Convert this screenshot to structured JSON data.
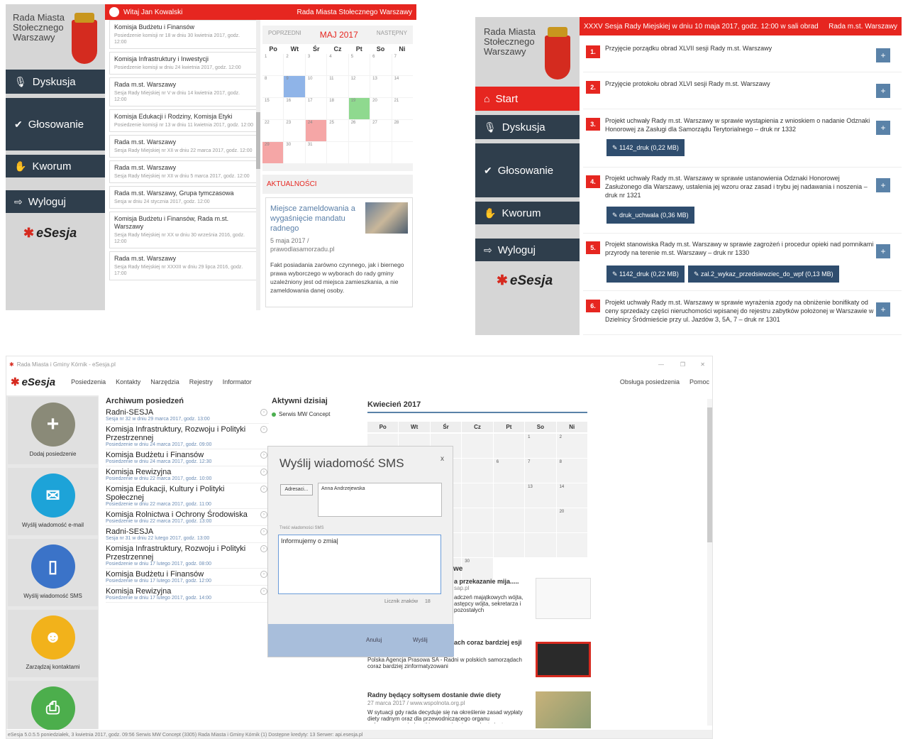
{
  "panelA": {
    "city": "Rada Miasta Stołecznego Warszawy",
    "header_user": "Witaj Jan Kowalski",
    "header_org": "Rada Miasta Stołecznego Warszawy",
    "nav": {
      "dyskusja": "Dyskusja",
      "glosowanie": "Głosowanie",
      "kworum": "Kworum",
      "wyloguj": "Wyloguj"
    },
    "logo": "eSesja",
    "items": [
      {
        "title": "Komisja Budżetu i Finansów",
        "sub": "Posiedzenie komisji nr 18 w dniu 30 kwietnia 2017, godz. 12:00"
      },
      {
        "title": "Komisja Infrastruktury i Inwestycji",
        "sub": "Posiedzenie komisji w dniu 24 kwietnia 2017, godz. 12:00"
      },
      {
        "title": "Rada m.st. Warszawy",
        "sub": "Sesja Rady Miejskiej nr V w dniu 14 kwietnia 2017, godz. 12:00"
      },
      {
        "title": "Komisja Edukacji i Rodziny, Komisja Etyki",
        "sub": "Posiedzenie komisji nr 13 w dniu 11 kwietnia 2017, godz. 12:00"
      },
      {
        "title": "Rada m.st. Warszawy",
        "sub": "Sesja Rady Miejskiej nr XII w dniu 22 marca 2017, godz. 12:00"
      },
      {
        "title": "Rada m.st. Warszawy",
        "sub": "Sesja Rady Miejskiej nr XII w dniu 5 marca 2017, godz. 12:00"
      },
      {
        "title": "Rada m.st. Warszawy, Grupa tymczasowa",
        "sub": "Sesja w dniu 24 stycznia 2017, godz. 12:00"
      },
      {
        "title": "Komisja Budżetu i Finansów, Rada m.st. Warszawy",
        "sub": "Sesja Rady Miejskiej nr XX w dniu 30 września 2016, godz. 12:00"
      },
      {
        "title": "Rada m.st. Warszawy",
        "sub": "Sesja Rady Miejskiej nr XXXIII w dniu 29 lipca 2016, godz. 17:00"
      }
    ],
    "cal": {
      "prev": "POPRZEDNI",
      "month": "MAJ 2017",
      "next": "NASTĘPNY",
      "days": [
        "Po",
        "Wt",
        "Śr",
        "Cz",
        "Pt",
        "So",
        "Ni"
      ],
      "cells": [
        "1",
        "2",
        "3",
        "4",
        "5",
        "6",
        "7",
        "8",
        "9",
        "10",
        "11",
        "12",
        "13",
        "14",
        "15",
        "16",
        "17",
        "18",
        "19",
        "20",
        "21",
        "22",
        "23",
        "24",
        "25",
        "26",
        "27",
        "28",
        "29",
        "30",
        "31",
        "",
        "",
        "",
        ""
      ],
      "colors": {
        "9": "#8fb4e8",
        "19": "#8fd98f",
        "24": "#f5a6a6",
        "29": "#f5a6a6"
      }
    },
    "news_label": "AKTUALNOŚCI",
    "news": {
      "title": "Miejsce zameldowania a wygaśnięcie mandatu radnego",
      "date": "5 maja 2017 / prawodlasamorzadu.pl",
      "body": "Fakt posiadania zarówno czynnego, jak i biernego prawa wyborczego w wyborach do rady gminy uzależniony jest od miejsca zamieszkania, a nie zameldowania danej osoby."
    }
  },
  "panelB": {
    "city": "Rada Miasta Stołecznego Warszawy",
    "header_title": "XXXV Sesja Rady Miejskiej w dniu 10 maja 2017, godz. 12:00 w sali obrad",
    "header_org": "Rada m.st. Warszawy",
    "nav": {
      "start": "Start",
      "dyskusja": "Dyskusja",
      "glosowanie": "Głosowanie",
      "kworum": "Kworum",
      "wyloguj": "Wyloguj"
    },
    "logo": "eSesja",
    "items": [
      {
        "num": "1.",
        "text": "Przyjęcie porządku obrad XLVII sesji Rady m.st. Warszawy",
        "plus": "+"
      },
      {
        "num": "2.",
        "text": "Przyjęcie protokołu obrad XLVI sesji Rady m.st. Warszawy",
        "plus": "+"
      },
      {
        "num": "3.",
        "text": "Projekt uchwały Rady m.st. Warszawy w sprawie wystąpienia z wnioskiem o nadanie Odznaki Honorowej za Zasługi dla Samorządu Terytorialnego – druk nr 1332",
        "plus": "+"
      },
      {
        "num": "4.",
        "text": "Projekt uchwały Rady m.st. Warszawy w sprawie ustanowienia Odznaki Honorowej Zasłużonego dla Warszawy, ustalenia jej wzoru oraz zasad i trybu jej nadawania i noszenia – druk nr 1321",
        "plus": "+"
      },
      {
        "num": "5.",
        "text": "Projekt stanowiska Rady m.st. Warszawy w sprawie zagrożeń i procedur opieki nad pomnikami przyrody na terenie m.st. Warszawy – druk nr 1330",
        "plus": "+"
      },
      {
        "num": "6.",
        "text": "Projekt uchwały Rady m.st. Warszawy w sprawie wyrażenia zgody na obniżenie bonifikaty od ceny sprzedaży części nieruchomości wpisanej do rejestru zabytków położonej w Warszawie w Dzielnicy Śródmieście przy ul. Jazdów 3, 5A, 7 – druk nr 1301",
        "plus": "+"
      }
    ],
    "attachments": {
      "a3": "✎ 1142_druk (0,22 MB)",
      "a4": "✎ druk_uchwala (0,36 MB)",
      "a5a": "✎ 1142_druk (0,22 MB)",
      "a5b": "✎ zal.2_wykaz_przedsiewziec_do_wpf (0,13 MB)"
    }
  },
  "panelC": {
    "window_title": "Rada Miasta i Gminy Kórnik - eSesja.pl",
    "menu": [
      "Posiedzenia",
      "Kontakty",
      "Narzędzia",
      "Rejestry",
      "Informator"
    ],
    "menu_right": [
      "Obsługa posiedzenia",
      "Pomoc"
    ],
    "logo": "eSesja",
    "tiles": [
      "Dodaj posiedzenie",
      "Wyślij wiadomość e-mail",
      "Wyślij wiadomość SMS",
      "Zarządzaj kontaktami"
    ],
    "archive_title": "Archiwum posiedzeń",
    "archive": [
      {
        "t": "Radni-SESJA",
        "s": "Sesja nr 32 w dniu 29 marca 2017, godz. 13:00"
      },
      {
        "t": "Komisja Infrastruktury, Rozwoju i Polityki Przestrzennej",
        "s": "Posiedzenie w dniu 24 marca 2017, godz. 09:00"
      },
      {
        "t": "Komisja Budżetu i Finansów",
        "s": "Posiedzenie w dniu 24 marca 2017, godz. 12:30"
      },
      {
        "t": "Komisja Rewizyjna",
        "s": "Posiedzenie w dniu 22 marca 2017, godz. 10:00"
      },
      {
        "t": "Komisja Edukacji, Kultury i Polityki Społecznej",
        "s": "Posiedzenie w dniu 22 marca 2017, godz. 11:00"
      },
      {
        "t": "Komisja Rolnictwa i Ochrony Środowiska",
        "s": "Posiedzenie w dniu 22 marca 2017, godz. 13:00"
      },
      {
        "t": "Radni-SESJA",
        "s": "Sesja nr 31 w dniu 22 lutego 2017, godz. 13:00"
      },
      {
        "t": "Komisja Infrastruktury, Rozwoju i Polityki Przestrzennej",
        "s": "Posiedzenie w dniu 17 lutego 2017, godz. 08:00"
      },
      {
        "t": "Komisja Budżetu i Finansów",
        "s": "Posiedzenie w dniu 17 lutego 2017, godz. 12:00"
      },
      {
        "t": "Komisja Rewizyjna",
        "s": "Posiedzenie w dniu 17 lutego 2017, godz. 14:00"
      }
    ],
    "active_title": "Aktywni dzisiaj",
    "active": [
      "Serwis MW Concept"
    ],
    "month": "Kwiecień 2017",
    "days": [
      "Po",
      "Wt",
      "Śr",
      "Cz",
      "Pt",
      "So",
      "Ni"
    ],
    "cells": [
      "",
      "",
      "",
      "",
      "",
      "1",
      "2",
      "",
      "",
      "",
      "",
      "6",
      "7",
      "8",
      "9",
      "",
      "",
      "",
      "",
      "13",
      "14",
      "15",
      "16",
      "",
      "",
      "",
      "",
      "20",
      "21",
      "22",
      "23",
      "",
      "",
      "",
      "",
      "27",
      "28",
      "29",
      "30"
    ],
    "news": [
      {
        "t": "a przekazanie mija.....",
        "src": "sap.pl",
        "body": "adczeń majątkowych wójta, astępcy wójta, sekretarza i pozostałych"
      },
      {
        "t": "ach coraz bardziej esji",
        "src": "28 marca 2017 / www.pap.pl",
        "body": "Polska Agencja Prasowa SA - Radni w polskich samorządach coraz bardziej zinformatyzowani"
      },
      {
        "t": "Radny będący sołtysem dostanie dwie diety",
        "src": "27 marca 2017 / www.wspolnota.org.pl",
        "body": "W sytuacji gdy rada decyduje się na określenie zasad wypłaty diety radnym oraz dla przewodniczącego organu wykonawczego jednostki pomocniczej, a osoba ta jest"
      }
    ],
    "news_partial_title": "we",
    "dialog": {
      "title": "Wyślij wiadomość SMS",
      "close": "x",
      "recipients_btn": "Adresaci...",
      "recipient": "Anna Andrzejewska",
      "label": "Treść wiadomości SMS",
      "text": "Informujemy o zmia",
      "counter_label": "Licznik znaków",
      "counter": "18",
      "cancel": "Anuluj",
      "send": "Wyślij"
    },
    "status": "eSesja 5.0.5.5     poniedziałek, 3 kwietnia 2017, godz. 09:56     Serwis MW Concept (3305) Rada Miasta i Gminy Kórnik (1)     Dostępne kredyty:  13  Serwer: api.esesja.pl"
  }
}
